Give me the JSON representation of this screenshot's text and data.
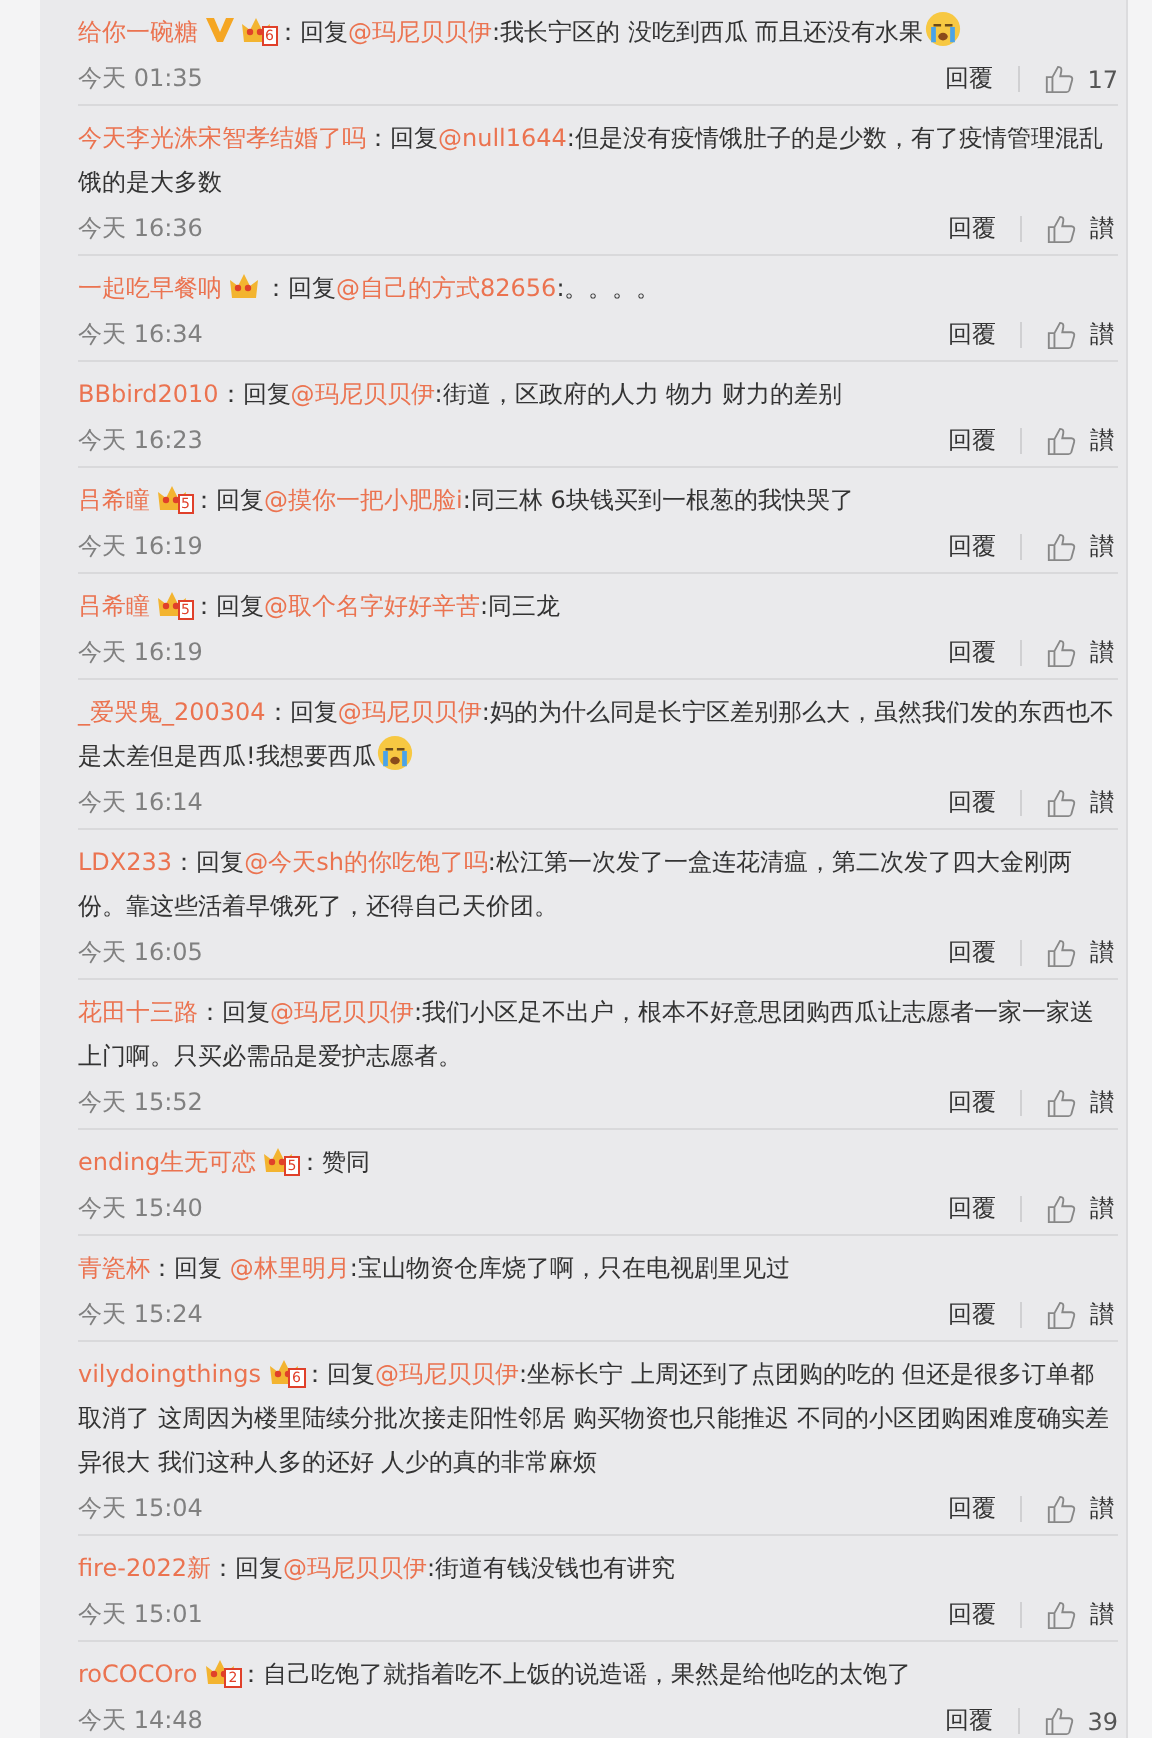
{
  "comments": [
    {
      "name": "给你一碗糖",
      "verified": true,
      "crown": true,
      "crown_level": "6",
      "sep": "：",
      "prefix": "回复",
      "mention": "@玛尼贝贝伊",
      "text": ":我长宁区的 没吃到西瓜 而且还没有水果",
      "emoji": true,
      "time": "今天 01:35",
      "reply": "回覆",
      "like": "17"
    },
    {
      "name": "今天李光洙宋智孝结婚了吗",
      "verified": false,
      "crown": false,
      "sep": "：",
      "prefix": "回复",
      "mention": "@null1644",
      "text": ":但是没有疫情饿肚子的是少数，有了疫情管理混乱饿的是大多数",
      "emoji": false,
      "time": "今天 16:36",
      "reply": "回覆",
      "like": "讃"
    },
    {
      "name": "一起吃早餐呐",
      "verified": false,
      "crown": true,
      "sep": "：",
      "prefix": "回复",
      "mention": "@自己的方式82656",
      "text": ":。。。。",
      "emoji": false,
      "time": "今天 16:34",
      "reply": "回覆",
      "like": "讃"
    },
    {
      "name": "BBbird2010",
      "verified": false,
      "crown": false,
      "sep": "：",
      "prefix": "回复",
      "mention": "@玛尼贝贝伊",
      "text": ":街道，区政府的人力 物力 财力的差别",
      "emoji": false,
      "time": "今天 16:23",
      "reply": "回覆",
      "like": "讃"
    },
    {
      "name": "吕希瞳",
      "verified": false,
      "crown": true,
      "crown_level": "5",
      "sep": "：",
      "prefix": "回复",
      "mention": "@摸你一把小肥脸i",
      "text": ":同三林 6块钱买到一根葱的我快哭了",
      "emoji": false,
      "time": "今天 16:19",
      "reply": "回覆",
      "like": "讃"
    },
    {
      "name": "吕希瞳",
      "verified": false,
      "crown": true,
      "crown_level": "5",
      "sep": "：",
      "prefix": "回复",
      "mention": "@取个名字好好辛苦",
      "text": ":同三龙",
      "emoji": false,
      "time": "今天 16:19",
      "reply": "回覆",
      "like": "讃"
    },
    {
      "name": "_爱哭鬼_200304",
      "verified": false,
      "crown": false,
      "sep": "：",
      "prefix": "回复",
      "mention": "@玛尼贝贝伊",
      "text": ":妈的为什么同是长宁区差别那么大，虽然我们发的东西也不是太差但是西瓜!我想要西瓜",
      "emoji": true,
      "time": "今天 16:14",
      "reply": "回覆",
      "like": "讃"
    },
    {
      "name": "LDX233",
      "verified": false,
      "crown": false,
      "sep": "：",
      "prefix": "回复",
      "mention": "@今天sh的你吃饱了吗",
      "text": ":松江第一次发了一盒连花清瘟，第二次发了四大金刚两份。靠这些活着早饿死了，还得自己天价团。",
      "emoji": false,
      "time": "今天 16:05",
      "reply": "回覆",
      "like": "讃"
    },
    {
      "name": "花田十三路",
      "verified": false,
      "crown": false,
      "sep": "：",
      "prefix": "回复",
      "mention": "@玛尼贝贝伊",
      "text": ":我们小区足不出户，根本不好意思团购西瓜让志愿者一家一家送上门啊。只买必需品是爱护志愿者。",
      "emoji": false,
      "time": "今天 15:52",
      "reply": "回覆",
      "like": "讃"
    },
    {
      "name": "ending生无可恋",
      "verified": false,
      "crown": true,
      "crown_level": "5",
      "sep": "：",
      "text": "赞同",
      "emoji": false,
      "time": "今天 15:40",
      "reply": "回覆",
      "like": "讃"
    },
    {
      "name": "青瓷杯",
      "verified": false,
      "crown": false,
      "sep": "：",
      "prefix": "回复 ",
      "mention": "@林里明月",
      "text": ":宝山物资仓库烧了啊，只在电视剧里见过",
      "emoji": false,
      "time": "今天 15:24",
      "reply": "回覆",
      "like": "讃"
    },
    {
      "name": "vilydoingthings",
      "verified": false,
      "crown": true,
      "crown_level": "6",
      "sep": "：",
      "prefix": "回复",
      "mention": "@玛尼贝贝伊",
      "text": ":坐标长宁 上周还到了点团购的吃的 但还是很多订单都取消了 这周因为楼里陆续分批次接走阳性邻居 购买物资也只能推迟 不同的小区团购困难度确实差异很大 我们这种人多的还好 人少的真的非常麻烦",
      "emoji": false,
      "time": "今天 15:04",
      "reply": "回覆",
      "like": "讃"
    },
    {
      "name": "fire-2022新",
      "verified": false,
      "crown": false,
      "sep": "：",
      "prefix": "回复",
      "mention": "@玛尼贝贝伊",
      "text": ":街道有钱没钱也有讲究",
      "emoji": false,
      "time": "今天 15:01",
      "reply": "回覆",
      "like": "讃"
    },
    {
      "name": "roCOCOro",
      "verified": false,
      "crown": true,
      "crown_level": "2",
      "sep": "：",
      "text": "自己吃饱了就指着吃不上饭的说造谣，果然是给他吃的太饱了",
      "emoji": false,
      "time": "今天 14:48",
      "reply": "回覆",
      "like": "39"
    }
  ]
}
